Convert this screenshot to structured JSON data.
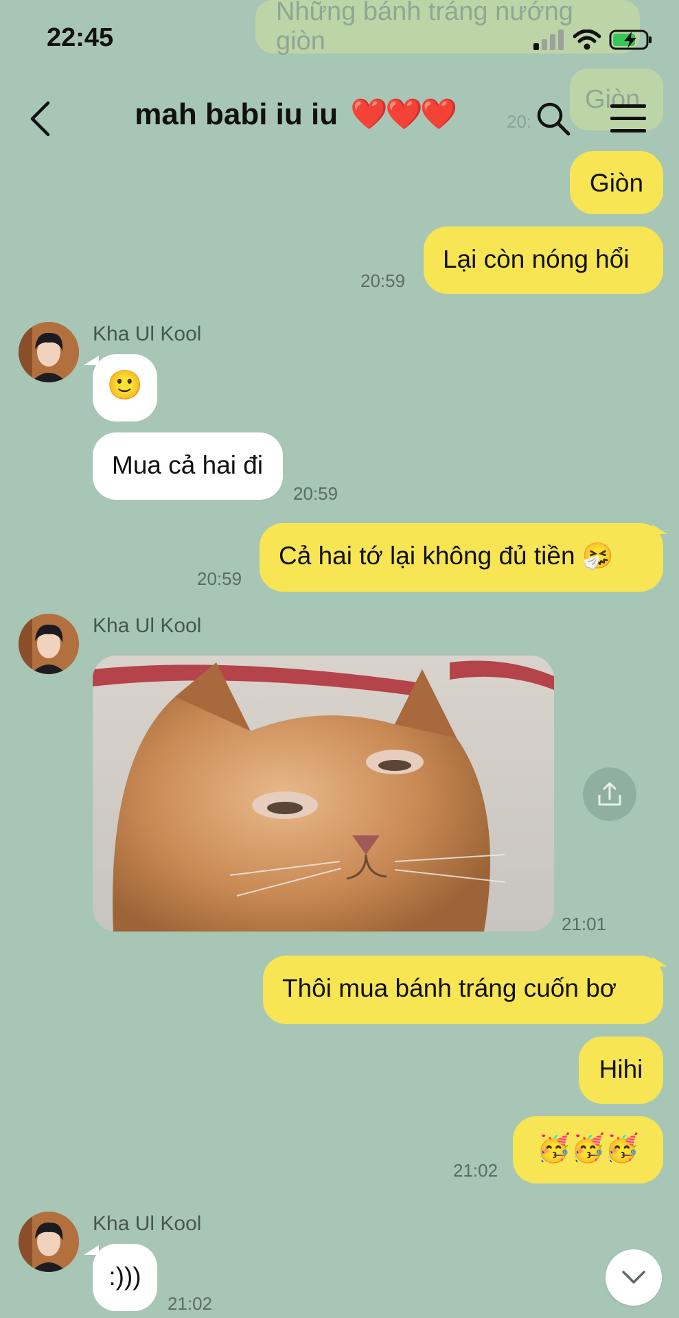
{
  "colors": {
    "background": "#a7c6b6",
    "outgoing_bubble": "#f7e553",
    "incoming_bubble": "#ffffff",
    "heart": "#e0262b"
  },
  "status_bar": {
    "time": "22:45"
  },
  "ghost": {
    "top_text": "Những bánh tráng nướng giòn",
    "second_text": "Giòn",
    "ts": "20:"
  },
  "header": {
    "title": "mah babi iu iu",
    "hearts": "❤️❤️❤️"
  },
  "messages": {
    "m1": {
      "text": "Giòn"
    },
    "m2": {
      "text": "Lại còn nóng hổi",
      "time": "20:59"
    },
    "group1": {
      "sender": "Kha Ul Kool"
    },
    "m3": {
      "text": "🙂"
    },
    "m4": {
      "text": "Mua cả hai đi",
      "time": "20:59"
    },
    "m5": {
      "text": "Cả hai tớ lại không đủ tiền 🤧",
      "time": "20:59"
    },
    "group2": {
      "sender": "Kha Ul Kool"
    },
    "m6": {
      "time": "21:01"
    },
    "m7": {
      "text": "Thôi mua bánh tráng cuốn bơ"
    },
    "m8": {
      "text": "Hihi"
    },
    "m9": {
      "text": "🥳🥳🥳",
      "time": "21:02"
    },
    "group3": {
      "sender": "Kha Ul Kool"
    },
    "m10": {
      "text": ":)))",
      "time": "21:02"
    }
  }
}
